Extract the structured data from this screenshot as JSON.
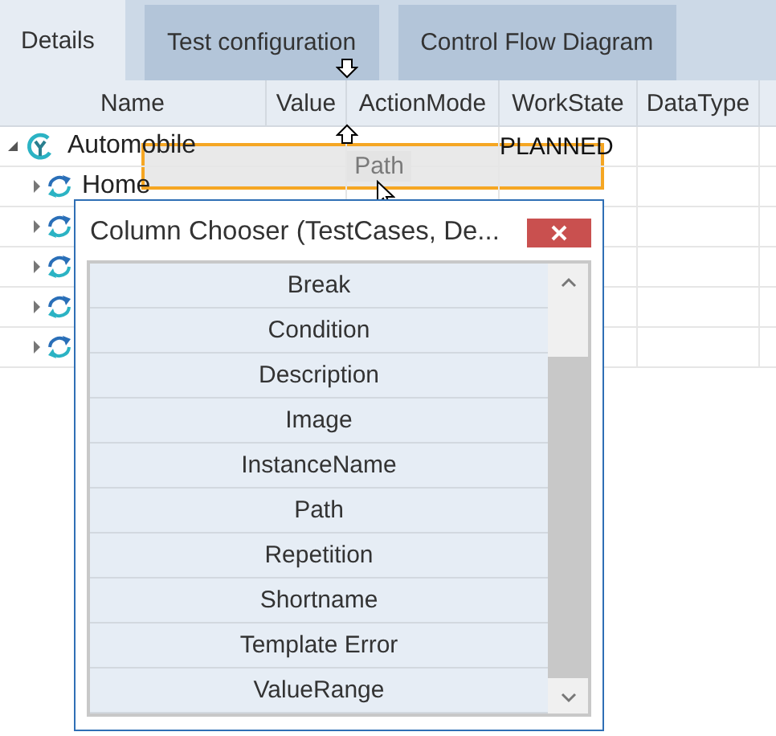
{
  "tabs": [
    {
      "label": "Details",
      "selected": true
    },
    {
      "label": "Test configuration",
      "selected": false
    },
    {
      "label": "Control Flow Diagram",
      "selected": false
    }
  ],
  "grid": {
    "columns": [
      "Name",
      "Value",
      "ActionMode",
      "WorkState",
      "DataType"
    ],
    "rows": [
      {
        "name": "Automobile",
        "expanded": true,
        "work_state": "PLANNED",
        "children": [
          {
            "name": "Home",
            "expanded": false
          },
          {
            "expanded": false
          },
          {
            "expanded": false
          },
          {
            "expanded": false
          },
          {
            "expanded": false
          }
        ]
      }
    ]
  },
  "drag_ghost": {
    "label": "Path"
  },
  "column_chooser": {
    "title": "Column Chooser (TestCases, De...",
    "items": [
      "Break",
      "Condition",
      "Description",
      "Image",
      "InstanceName",
      "Path",
      "Repetition",
      "Shortname",
      "Template Error",
      "ValueRange"
    ]
  }
}
